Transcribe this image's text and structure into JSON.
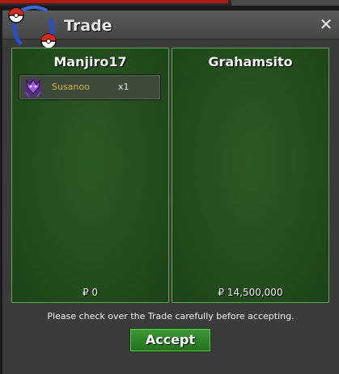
{
  "window": {
    "title": "Trade",
    "close_symbol": "✕"
  },
  "left_panel": {
    "player": "Manjiro17",
    "money": "₽ 0",
    "items": [
      {
        "name": "Susanoo",
        "quantity": "x1",
        "icon": "susanoo-icon"
      }
    ]
  },
  "right_panel": {
    "player": "Grahamsito",
    "money": "₽ 14,500,000",
    "items": []
  },
  "notice": "Please check over the Trade carefully before accepting.",
  "accept_label": "Accept",
  "colors": {
    "panel_border": "#5ea852",
    "accept_green": "#2f8a2a",
    "item_name": "#d9b34a"
  }
}
